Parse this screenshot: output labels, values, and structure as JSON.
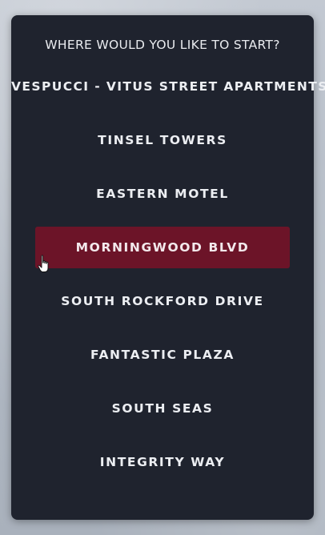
{
  "menu": {
    "title": "WHERE WOULD YOU LIKE TO START?",
    "options": [
      {
        "label": "VESPUCCI - VITUS STREET APARTMENTS",
        "selected": false
      },
      {
        "label": "TINSEL TOWERS",
        "selected": false
      },
      {
        "label": "EASTERN MOTEL",
        "selected": false
      },
      {
        "label": "MORNINGWOOD BLVD",
        "selected": true
      },
      {
        "label": "SOUTH ROCKFORD DRIVE",
        "selected": false
      },
      {
        "label": "FANTASTIC PLAZA",
        "selected": false
      },
      {
        "label": "SOUTH SEAS",
        "selected": false
      },
      {
        "label": "INTEGRITY WAY",
        "selected": false
      }
    ]
  },
  "colors": {
    "panel_background": "#1f232e",
    "selected_highlight": "#6c1428",
    "text": "#eceef2"
  },
  "cursor": {
    "icon": "hand-pointer-icon"
  }
}
